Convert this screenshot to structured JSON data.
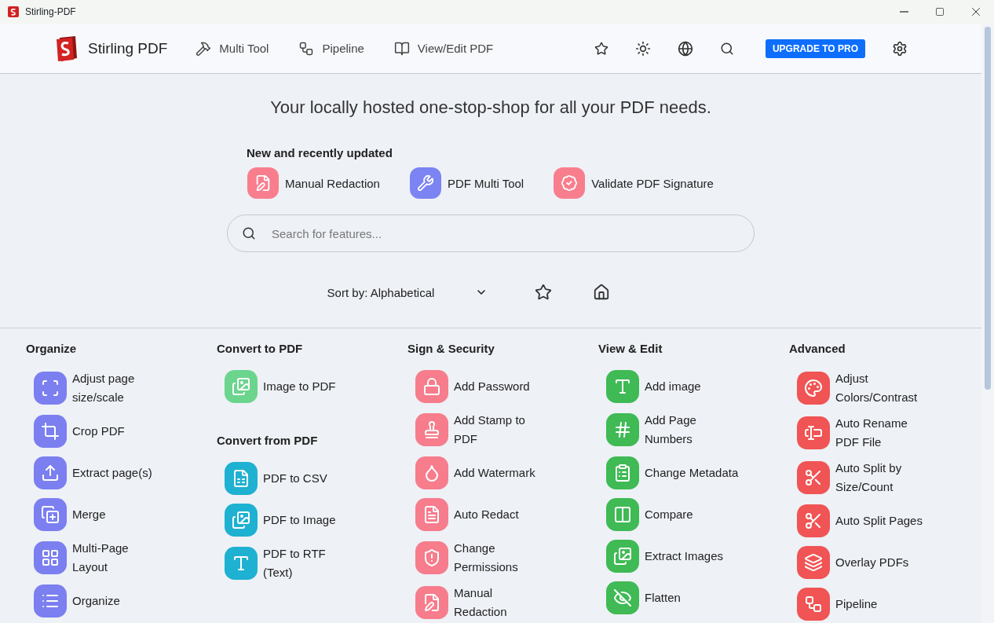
{
  "window": {
    "title": "Stirling-PDF"
  },
  "nav": {
    "brand": "Stirling PDF",
    "links": [
      {
        "label": "Multi Tool"
      },
      {
        "label": "Pipeline"
      },
      {
        "label": "View/Edit PDF"
      }
    ],
    "upgrade_button": "UPGRADE TO PRO"
  },
  "hero": {
    "title": "Your locally hosted one-stop-shop for all your PDF needs.",
    "recent_heading": "New and recently updated",
    "recent": [
      {
        "label": "Manual Redaction",
        "color": "#f87e8e"
      },
      {
        "label": "PDF Multi Tool",
        "color": "#7c83f2"
      },
      {
        "label": "Validate PDF Signature",
        "color": "#f87e8e"
      }
    ]
  },
  "search": {
    "placeholder": "Search for features..."
  },
  "sort": {
    "value": "Sort by: Alphabetical"
  },
  "columns": [
    {
      "sections": [
        {
          "title": "Organize",
          "color": "#7b7ff0",
          "items": [
            {
              "label": "Adjust page size/scale"
            },
            {
              "label": "Crop PDF"
            },
            {
              "label": "Extract page(s)"
            },
            {
              "label": "Merge"
            },
            {
              "label": "Multi-Page Layout"
            },
            {
              "label": "Organize"
            }
          ]
        }
      ]
    },
    {
      "sections": [
        {
          "title": "Convert to PDF",
          "color": "#6bd58e",
          "items": [
            {
              "label": "Image to PDF"
            }
          ]
        },
        {
          "title": "Convert from PDF",
          "color": "#1eb1d1",
          "items": [
            {
              "label": "PDF to CSV"
            },
            {
              "label": "PDF to Image"
            },
            {
              "label": "PDF to RTF (Text)"
            }
          ]
        }
      ]
    },
    {
      "sections": [
        {
          "title": "Sign & Security",
          "color": "#f77c8c",
          "items": [
            {
              "label": "Add Password"
            },
            {
              "label": "Add Stamp to PDF"
            },
            {
              "label": "Add Watermark"
            },
            {
              "label": "Auto Redact"
            },
            {
              "label": "Change Permissions"
            },
            {
              "label": "Manual Redaction"
            }
          ]
        }
      ]
    },
    {
      "sections": [
        {
          "title": "View & Edit",
          "color": "#3fba55",
          "items": [
            {
              "label": "Add image"
            },
            {
              "label": "Add Page Numbers"
            },
            {
              "label": "Change Metadata"
            },
            {
              "label": "Compare"
            },
            {
              "label": "Extract Images"
            },
            {
              "label": "Flatten"
            }
          ]
        }
      ]
    },
    {
      "sections": [
        {
          "title": "Advanced",
          "color": "#f05454",
          "items": [
            {
              "label": "Adjust Colors/Contrast"
            },
            {
              "label": "Auto Rename PDF File"
            },
            {
              "label": "Auto Split by Size/Count"
            },
            {
              "label": "Auto Split Pages"
            },
            {
              "label": "Overlay PDFs"
            },
            {
              "label": "Pipeline"
            }
          ]
        }
      ]
    }
  ]
}
